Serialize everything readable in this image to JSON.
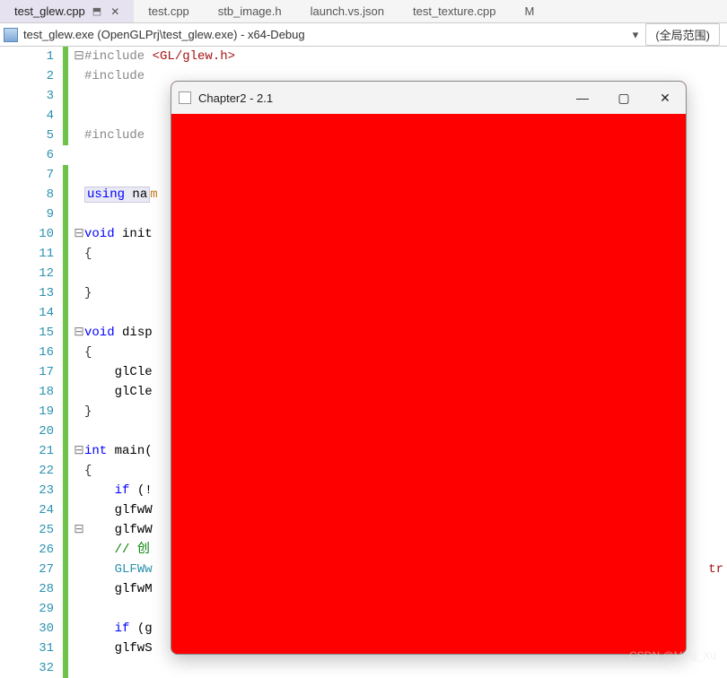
{
  "tabs": [
    {
      "label": "test_glew.cpp",
      "active": true,
      "pinned": true
    },
    {
      "label": "test.cpp"
    },
    {
      "label": "stb_image.h"
    },
    {
      "label": "launch.vs.json"
    },
    {
      "label": "test_texture.cpp"
    },
    {
      "label": "M"
    }
  ],
  "infobar": {
    "target_label": "test_glew.exe (OpenGLPrj\\test_glew.exe) - x64-Debug",
    "scope_label": "(全局范围)"
  },
  "code": {
    "lines": [
      {
        "n": 1,
        "pre": "⊟",
        "html": "<span class='cut'>#include</span> <span class='str'>&lt;GL/glew.h&gt;</span>"
      },
      {
        "n": 2,
        "html": "<span class='cut'>#include</span>"
      },
      {
        "n": 3,
        "html": ""
      },
      {
        "n": 4,
        "html": ""
      },
      {
        "n": 5,
        "html": "<span class='cut'>#include</span>"
      },
      {
        "n": 6,
        "html": "",
        "modbreak": true
      },
      {
        "n": 7,
        "html": ""
      },
      {
        "n": 8,
        "html": "<span class='box-highlight'><span class='kwd'>using</span> na</span><span class='ograngeish'>m</span>"
      },
      {
        "n": 9,
        "html": ""
      },
      {
        "n": 10,
        "pre": "⊟",
        "html": "<span class='kwd'>void</span> init"
      },
      {
        "n": 11,
        "html": "<span class='brace'>{</span>"
      },
      {
        "n": 12,
        "html": ""
      },
      {
        "n": 13,
        "html": "<span class='brace'>}</span>"
      },
      {
        "n": 14,
        "html": ""
      },
      {
        "n": 15,
        "pre": "⊟",
        "html": "<span class='kwd'>void</span> disp"
      },
      {
        "n": 16,
        "html": "<span class='brace'>{</span>"
      },
      {
        "n": 17,
        "html": "    glCle"
      },
      {
        "n": 18,
        "html": "    glCle"
      },
      {
        "n": 19,
        "html": "<span class='brace'>}</span>"
      },
      {
        "n": 20,
        "html": ""
      },
      {
        "n": 21,
        "pre": "⊟",
        "html": "<span class='kwd'>int</span> main("
      },
      {
        "n": 22,
        "html": "<span class='brace'>{</span>"
      },
      {
        "n": 23,
        "html": "    <span class='kwd'>if</span> (!"
      },
      {
        "n": 24,
        "html": "    glfwW"
      },
      {
        "n": 25,
        "pre": "⊟",
        "html": "    glfwW"
      },
      {
        "n": 26,
        "html": "    <span class='comment'>// 创</span>"
      },
      {
        "n": 27,
        "html": "    <span class='type'>GLFWw</span>",
        "tail": "<span style='color:#a31515'>tr</span>"
      },
      {
        "n": 28,
        "html": "    glfwM"
      },
      {
        "n": 29,
        "html": ""
      },
      {
        "n": 30,
        "html": "    <span class='kwd'>if</span> (g"
      },
      {
        "n": 31,
        "html": "    glfwS"
      },
      {
        "n": 32,
        "html": ""
      }
    ]
  },
  "popup": {
    "title": "Chapter2 - 2.1"
  },
  "watermark": "CSDN @Ming_Xu"
}
